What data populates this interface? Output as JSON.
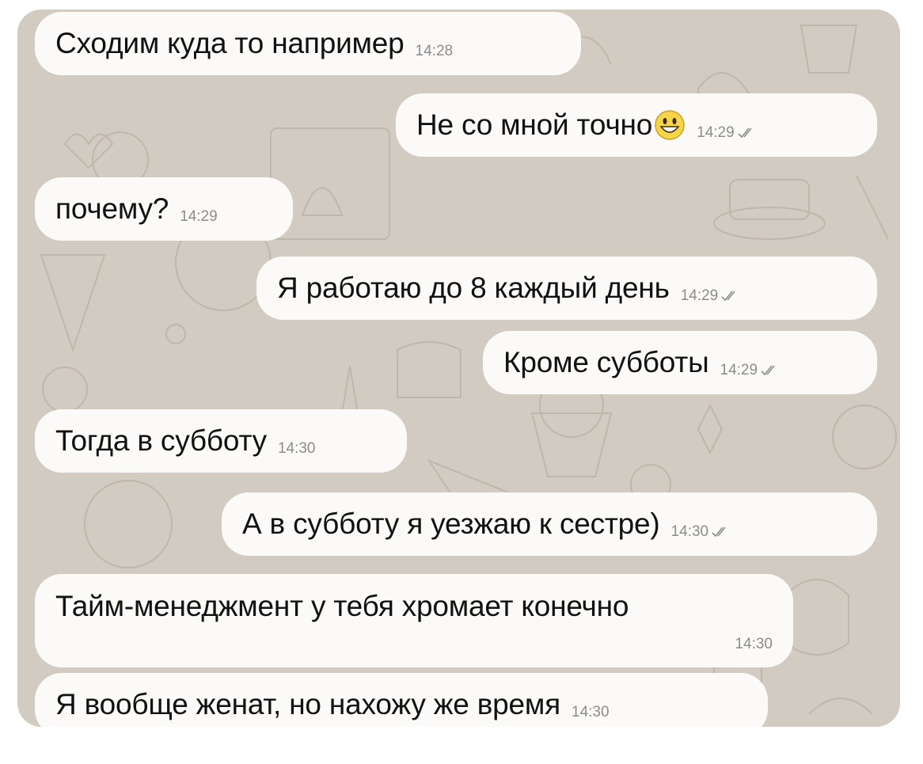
{
  "messages": [
    {
      "direction": "in",
      "text": "Сходим куда то например",
      "time": "14:28"
    },
    {
      "direction": "out",
      "text": "Не со мной точно",
      "time": "14:29",
      "emoji": "grinning-face-emoji",
      "read": true
    },
    {
      "direction": "in",
      "text": "почему?",
      "time": "14:29"
    },
    {
      "direction": "out",
      "text": "Я работаю до 8 каждый день",
      "time": "14:29",
      "read": true
    },
    {
      "direction": "out",
      "text": "Кроме субботы",
      "time": "14:29",
      "read": true
    },
    {
      "direction": "in",
      "text": "Тогда в субботу",
      "time": "14:30"
    },
    {
      "direction": "out",
      "text": "А в субботу я уезжаю к сестре)",
      "time": "14:30",
      "read": true
    },
    {
      "direction": "in",
      "text": "Тайм-менеджмент у тебя хромает конечно",
      "time": "14:30"
    },
    {
      "direction": "in",
      "text": "Я вообще женат, но нахожу же время",
      "time": "14:30"
    }
  ],
  "colors": {
    "wallpaper": "#d2cbc1",
    "bubble": "#fbfaf8",
    "text": "#111111",
    "meta": "#8c8c8c"
  },
  "icons": {
    "read_receipt": "double-check-icon",
    "emoji": "grinning-face-emoji"
  }
}
